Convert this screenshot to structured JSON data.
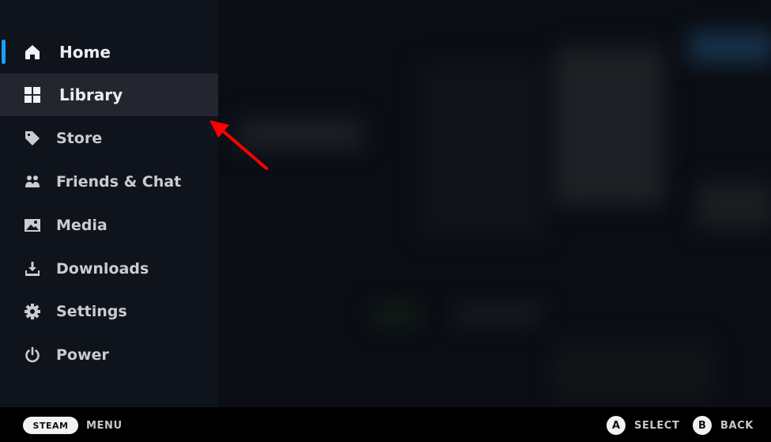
{
  "sidebar": {
    "active_color": "#1a9fff",
    "items": [
      {
        "label": "Home",
        "icon": "home-icon",
        "active": true
      },
      {
        "label": "Library",
        "icon": "library-grid-icon",
        "selected": true
      },
      {
        "label": "Store",
        "icon": "tag-icon"
      },
      {
        "label": "Friends & Chat",
        "icon": "friends-icon"
      },
      {
        "label": "Media",
        "icon": "image-icon"
      },
      {
        "label": "Downloads",
        "icon": "download-icon"
      },
      {
        "label": "Settings",
        "icon": "gear-icon"
      },
      {
        "label": "Power",
        "icon": "power-icon"
      }
    ]
  },
  "footer": {
    "steam_button": "STEAM",
    "steam_action": "MENU",
    "a_button": "A",
    "a_action": "SELECT",
    "b_button": "B",
    "b_action": "BACK"
  },
  "annotation": {
    "type": "arrow",
    "color": "#ff0000",
    "points_to": "Library"
  }
}
